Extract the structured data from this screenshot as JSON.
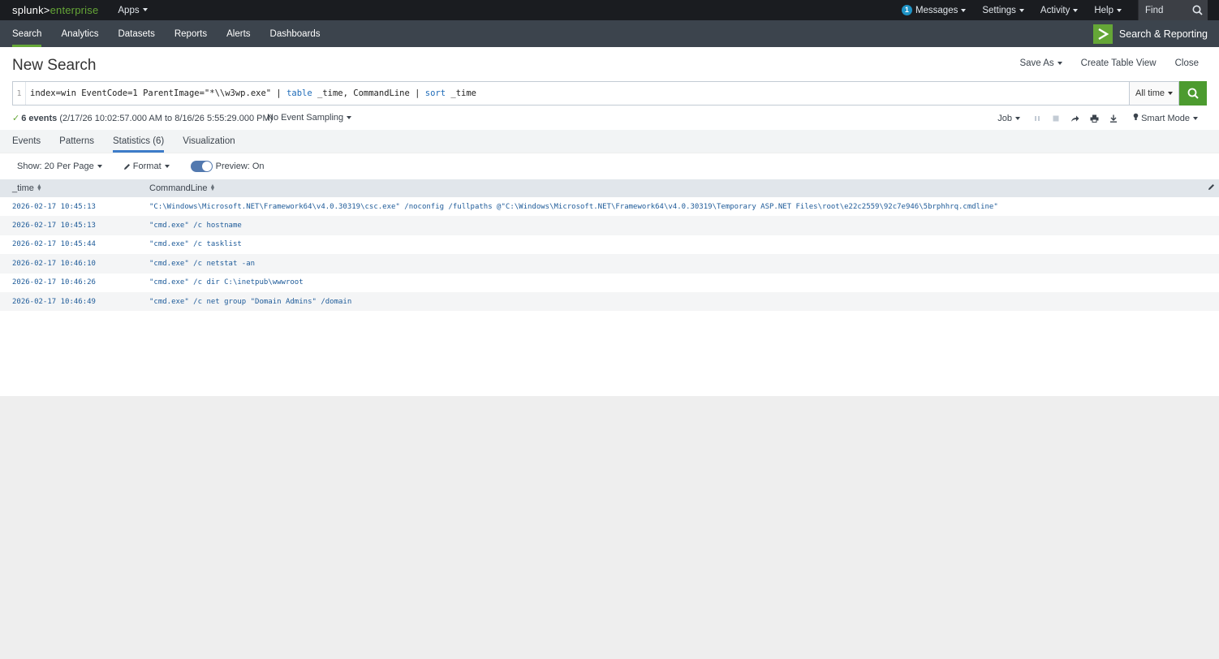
{
  "topbar": {
    "logo_part1": "splunk>",
    "logo_part2": "enterprise",
    "apps": "Apps",
    "messages_count": "1",
    "messages": "Messages",
    "settings": "Settings",
    "activity": "Activity",
    "help": "Help",
    "find": "Find"
  },
  "appbar": {
    "tabs": [
      "Search",
      "Analytics",
      "Datasets",
      "Reports",
      "Alerts",
      "Dashboards"
    ],
    "app_title": "Search & Reporting"
  },
  "header": {
    "title": "New Search",
    "save_as": "Save As",
    "create_table_view": "Create Table View",
    "close": "Close"
  },
  "search": {
    "line_number": "1",
    "query_part1": "index=win EventCode=1 ParentImage=\"*\\\\w3wp.exe\" | ",
    "query_kw1": "table",
    "query_part2": " _time, CommandLine | ",
    "query_kw2": "sort",
    "query_part3": " _time",
    "time_range": "All time"
  },
  "status": {
    "events_count": "6 events",
    "events_range": "(2/17/26 10:02:57.000 AM to 8/16/26 5:55:29.000 PM)",
    "sampling": "No Event Sampling",
    "job": "Job",
    "mode": "Smart Mode"
  },
  "tabs": [
    "Events",
    "Patterns",
    "Statistics (6)",
    "Visualization"
  ],
  "controls": {
    "per_page": "Show: 20 Per Page",
    "format": "Format",
    "preview": "Preview: On"
  },
  "table": {
    "columns": [
      "_time",
      "CommandLine"
    ],
    "rows": [
      {
        "time": "2026-02-17 10:45:13",
        "cmd": "\"C:\\Windows\\Microsoft.NET\\Framework64\\v4.0.30319\\csc.exe\" /noconfig /fullpaths @\"C:\\Windows\\Microsoft.NET\\Framework64\\v4.0.30319\\Temporary ASP.NET Files\\root\\e22c2559\\92c7e946\\5brphhrq.cmdline\""
      },
      {
        "time": "2026-02-17 10:45:13",
        "cmd": "\"cmd.exe\" /c hostname"
      },
      {
        "time": "2026-02-17 10:45:44",
        "cmd": "\"cmd.exe\" /c tasklist"
      },
      {
        "time": "2026-02-17 10:46:10",
        "cmd": "\"cmd.exe\" /c netstat -an"
      },
      {
        "time": "2026-02-17 10:46:26",
        "cmd": "\"cmd.exe\" /c dir C:\\inetpub\\wwwroot"
      },
      {
        "time": "2026-02-17 10:46:49",
        "cmd": "\"cmd.exe\" /c net group \"Domain Admins\" /domain"
      }
    ]
  }
}
